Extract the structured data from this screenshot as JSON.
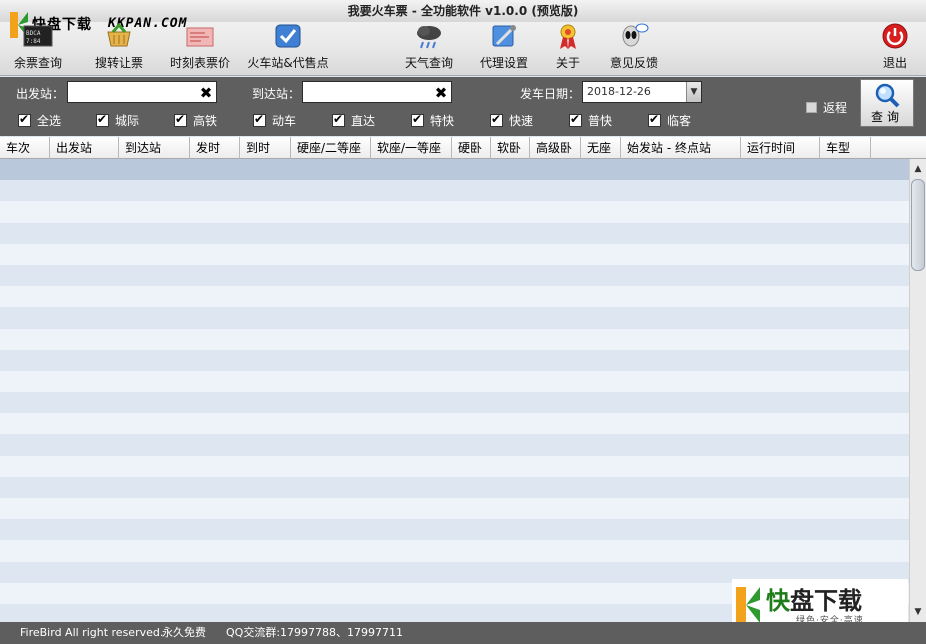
{
  "window": {
    "title": "我要火车票 - 全功能软件 v1.0.0 (预览版)"
  },
  "watermark": {
    "top_cn": "快盘下载",
    "top_en": "KKPAN.COM",
    "bottom_big_1": "快",
    "bottom_big_2": "盘下载",
    "bottom_small": "绿色·安全·高速"
  },
  "toolbar": {
    "remaining": "余票查询",
    "transfer": "搜转让票",
    "timetable": "时刻表票价",
    "stations": "火车站&代售点",
    "weather": "天气查询",
    "proxy": "代理设置",
    "about": "关于",
    "feedback": "意见反馈",
    "exit": "退出"
  },
  "search": {
    "from_label": "出发站：",
    "from_value": "",
    "to_label": "到达站：",
    "to_value": "",
    "date_label": "发车日期：",
    "date_value": "2018-12-26",
    "round_trip_label": "返程",
    "query_label": "查询",
    "clear_glyph": "✖",
    "check_glyph": "✔"
  },
  "filters": [
    {
      "label": "全选",
      "checked": true
    },
    {
      "label": "城际",
      "checked": true
    },
    {
      "label": "高铁",
      "checked": true
    },
    {
      "label": "动车",
      "checked": true
    },
    {
      "label": "直达",
      "checked": true
    },
    {
      "label": "特快",
      "checked": true
    },
    {
      "label": "快速",
      "checked": true
    },
    {
      "label": "普快",
      "checked": true
    },
    {
      "label": "临客",
      "checked": true
    }
  ],
  "table": {
    "columns": [
      "车次",
      "出发站",
      "到达站",
      "发时",
      "到时",
      "硬座/二等座",
      "软座/一等座",
      "硬卧",
      "软卧",
      "高级卧",
      "无座",
      "始发站 - 终点站",
      "运行时间",
      "车型"
    ],
    "rows": []
  },
  "status": {
    "copyright": "FireBird All right reserved.",
    "free": "永久免费",
    "qq": "QQ交流群:17997788、17997711"
  },
  "colors": {
    "panel": "#5f5f5f",
    "row_odd": "#dde6f1",
    "row_even": "#eef3f9",
    "accent_logo_green": "#1e7d1a",
    "exit_red": "#d81e1e"
  }
}
